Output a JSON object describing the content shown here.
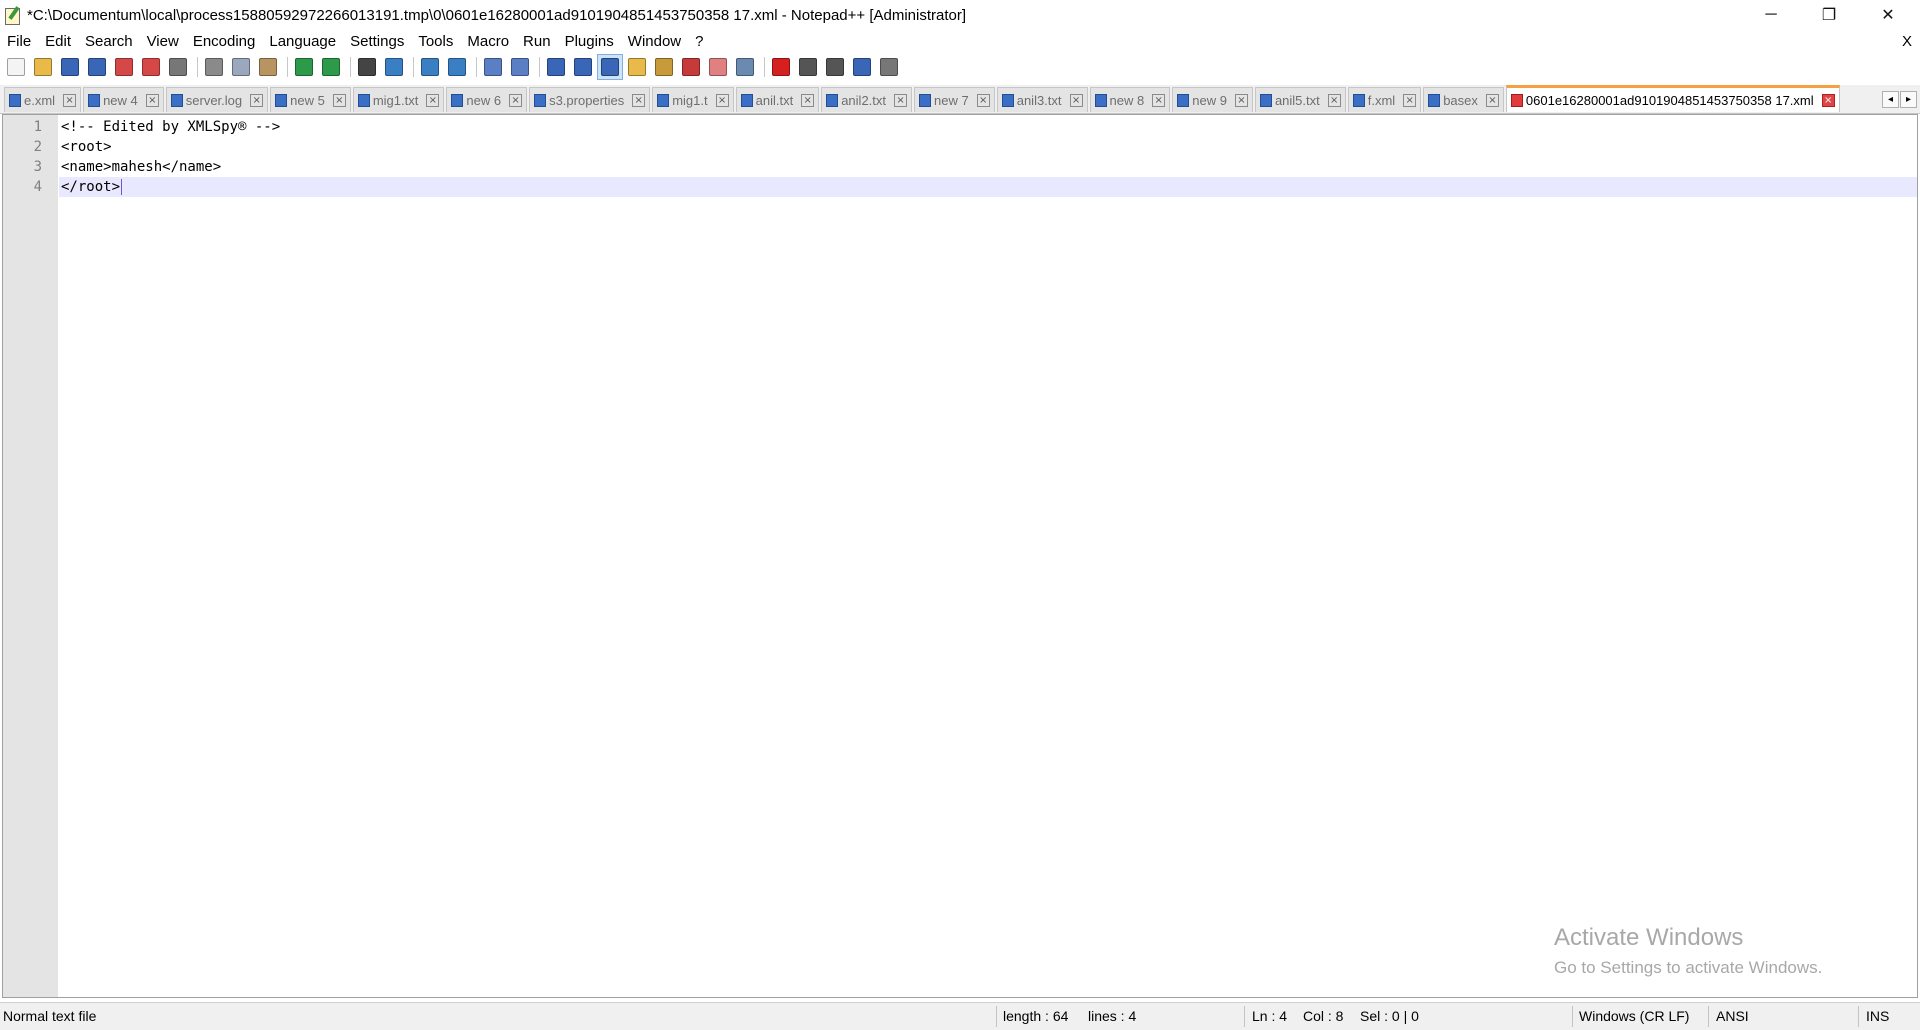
{
  "window": {
    "title": "*C:\\Documentum\\local\\process15880592972266013191.tmp\\0\\0601e16280001ad9101904851453750358 17.xml - Notepad++ [Administrator]",
    "minimize_glyph": "─",
    "maximize_glyph": "❐",
    "close_glyph": "✕"
  },
  "menu": {
    "items": [
      "File",
      "Edit",
      "Search",
      "View",
      "Encoding",
      "Language",
      "Settings",
      "Tools",
      "Macro",
      "Run",
      "Plugins",
      "Window",
      "?"
    ],
    "close_label": "X"
  },
  "toolbar": {
    "icons": [
      {
        "name": "new-file-icon",
        "color": "#f4f4f4"
      },
      {
        "name": "open-file-icon",
        "color": "#e9b949"
      },
      {
        "name": "save-icon",
        "color": "#3a66b7"
      },
      {
        "name": "save-all-icon",
        "color": "#3a66b7"
      },
      {
        "name": "close-file-icon",
        "color": "#d64848"
      },
      {
        "name": "close-all-icon",
        "color": "#d64848"
      },
      {
        "name": "print-icon",
        "color": "#777777"
      },
      {
        "name": "sep"
      },
      {
        "name": "cut-icon",
        "color": "#8a8a8a"
      },
      {
        "name": "copy-icon",
        "color": "#9aa7bd"
      },
      {
        "name": "paste-icon",
        "color": "#b89560"
      },
      {
        "name": "sep"
      },
      {
        "name": "undo-icon",
        "color": "#2d9a4a"
      },
      {
        "name": "redo-icon",
        "color": "#2d9a4a"
      },
      {
        "name": "sep"
      },
      {
        "name": "find-icon",
        "color": "#444444"
      },
      {
        "name": "replace-icon",
        "color": "#3a7fc4"
      },
      {
        "name": "sep"
      },
      {
        "name": "zoom-in-icon",
        "color": "#3a7fc4"
      },
      {
        "name": "zoom-out-icon",
        "color": "#3a7fc4"
      },
      {
        "name": "sep"
      },
      {
        "name": "sync-vertical-icon",
        "color": "#5a7fc4"
      },
      {
        "name": "sync-horizontal-icon",
        "color": "#5a7fc4"
      },
      {
        "name": "sep"
      },
      {
        "name": "word-wrap-icon",
        "color": "#3a66b7"
      },
      {
        "name": "show-all-characters-icon",
        "color": "#3a66b7"
      },
      {
        "name": "indent-guide-icon",
        "color": "#3a66b7",
        "active": true
      },
      {
        "name": "doc-map-icon",
        "color": "#e9b949"
      },
      {
        "name": "function-list-icon",
        "color": "#c79a3a"
      },
      {
        "name": "user-lang-icon",
        "color": "#c73a3a"
      },
      {
        "name": "folder-workspace-icon",
        "color": "#e08080"
      },
      {
        "name": "monitoring-icon",
        "color": "#6a8ab0"
      },
      {
        "name": "sep"
      },
      {
        "name": "record-macro-icon",
        "color": "#d62020"
      },
      {
        "name": "stop-recording-icon",
        "color": "#555555"
      },
      {
        "name": "play-macro-icon",
        "color": "#555555"
      },
      {
        "name": "run-macro-multiple-icon",
        "color": "#3a66b7"
      },
      {
        "name": "save-macro-icon",
        "color": "#777777"
      }
    ]
  },
  "tabs": {
    "items": [
      {
        "label": "e.xml",
        "active": false
      },
      {
        "label": "new 4",
        "active": false
      },
      {
        "label": "server.log",
        "active": false
      },
      {
        "label": "new 5",
        "active": false
      },
      {
        "label": "mig1.txt",
        "active": false
      },
      {
        "label": "new 6",
        "active": false
      },
      {
        "label": "s3.properties",
        "active": false
      },
      {
        "label": "mig1.t",
        "active": false
      },
      {
        "label": "anil.txt",
        "active": false
      },
      {
        "label": "anil2.txt",
        "active": false
      },
      {
        "label": "new 7",
        "active": false
      },
      {
        "label": "anil3.txt",
        "active": false
      },
      {
        "label": "new 8",
        "active": false
      },
      {
        "label": "new 9",
        "active": false
      },
      {
        "label": "anil5.txt",
        "active": false
      },
      {
        "label": "f.xml",
        "active": false
      },
      {
        "label": "basex",
        "active": false
      },
      {
        "label": "0601e16280001ad9101904851453750358 17.xml",
        "active": true
      }
    ],
    "close_glyph": "×",
    "scroll_left": "◂",
    "scroll_right": "▸"
  },
  "editor": {
    "line_numbers": [
      "1",
      "2",
      "3",
      "4"
    ],
    "lines": [
      "<!-- Edited by XMLSpy® -->",
      "<root>",
      "<name>mahesh</name>",
      "</root>"
    ],
    "current_line": 4
  },
  "watermark": {
    "line1": "Activate Windows",
    "line2": "Go to Settings to activate Windows."
  },
  "status": {
    "file_type": "Normal text file",
    "length": "length : 64",
    "lines": "lines : 4",
    "ln": "Ln : 4",
    "col": "Col : 8",
    "sel": "Sel : 0 | 0",
    "eol": "Windows (CR LF)",
    "encoding": "ANSI",
    "mode": "INS"
  }
}
